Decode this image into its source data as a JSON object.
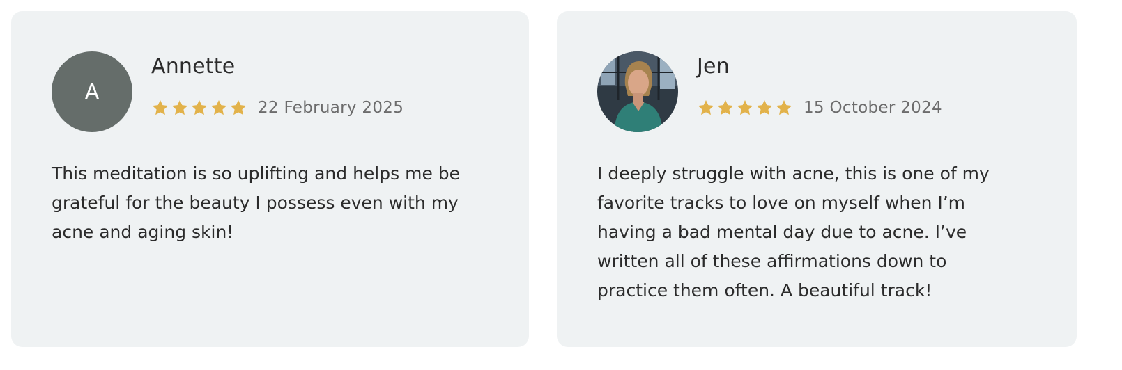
{
  "colors": {
    "card_bg": "#eff2f3",
    "star": "#e2b24a",
    "avatar_bg": "#656d6a",
    "date_text": "#6c6c6c",
    "body_text": "#2b2b2b"
  },
  "reviews": [
    {
      "avatar": {
        "type": "initial",
        "initial": "A"
      },
      "name": "Annette",
      "rating": 5,
      "date": "22 February 2025",
      "text": "This meditation is so uplifting and helps me be grateful for the beauty I possess even with my acne and aging skin!"
    },
    {
      "avatar": {
        "type": "photo"
      },
      "name": "Jen",
      "rating": 5,
      "date": "15 October 2024",
      "text": "I deeply struggle with acne, this is one of my favorite tracks to love on myself when I’m having a bad mental day due to acne. I’ve written all of these affirmations down to practice them often. A beautiful track!"
    }
  ]
}
